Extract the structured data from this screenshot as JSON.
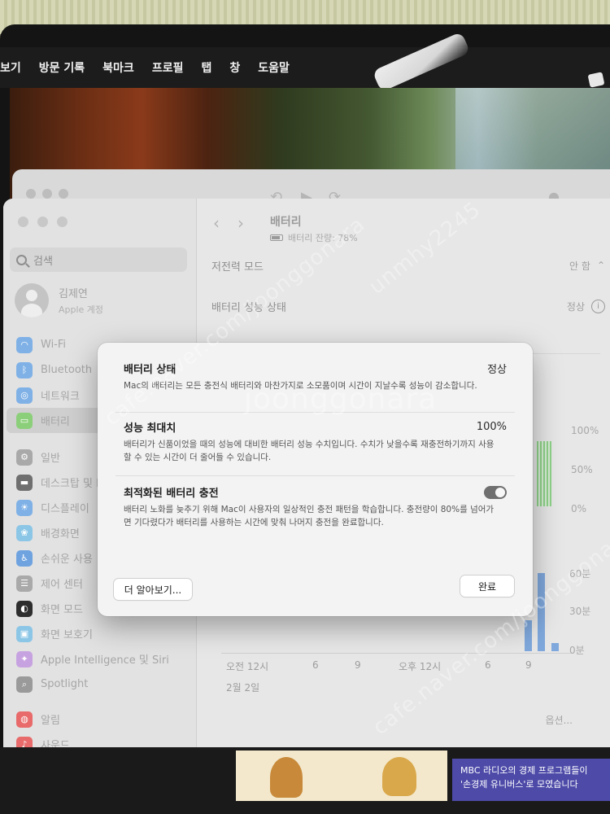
{
  "menubar": {
    "items": [
      "보기",
      "방문 기록",
      "북마크",
      "프로필",
      "탭",
      "창",
      "도움말"
    ]
  },
  "settings": {
    "search_placeholder": "검색",
    "user": {
      "name": "김제연",
      "subtitle": "Apple 계정"
    },
    "sidebar_items": [
      {
        "label": "Wi-Fi",
        "icon": "wifi-icon",
        "color": "#7fb1e6"
      },
      {
        "label": "Bluetooth",
        "icon": "bluetooth-icon",
        "color": "#7fb1e6"
      },
      {
        "label": "네트워크",
        "icon": "globe-icon",
        "color": "#7fb1e6"
      },
      {
        "label": "배터리",
        "icon": "battery-icon",
        "color": "#8ccf7a",
        "active": true
      },
      {
        "label": "일반",
        "icon": "gear-icon",
        "color": "#a9a9a9"
      },
      {
        "label": "데스크탑 및 Dock",
        "icon": "dock-icon",
        "color": "#6f6f6f"
      },
      {
        "label": "디스플레이",
        "icon": "display-icon",
        "color": "#7fb1e6"
      },
      {
        "label": "배경화면",
        "icon": "wallpaper-icon",
        "color": "#8cc6e6"
      },
      {
        "label": "손쉬운 사용",
        "icon": "accessibility-icon",
        "color": "#6fa3e0"
      },
      {
        "label": "제어 센터",
        "icon": "control-center-icon",
        "color": "#a9a9a9"
      },
      {
        "label": "화면 모드",
        "icon": "appearance-icon",
        "color": "#2e2e2e"
      },
      {
        "label": "화면 보호기",
        "icon": "screensaver-icon",
        "color": "#8cc6e6"
      },
      {
        "label": "Apple Intelligence 및 Siri",
        "icon": "siri-icon",
        "color": "#c7a2e0"
      },
      {
        "label": "Spotlight",
        "icon": "spotlight-icon",
        "color": "#9a9a9a"
      },
      {
        "label": "알림",
        "icon": "bell-icon",
        "color": "#e86a6a"
      },
      {
        "label": "사운드",
        "icon": "speaker-icon",
        "color": "#e86a6a"
      }
    ],
    "main": {
      "title": "배터리",
      "subtitle": "배터리 잔량: 78%",
      "low_power": {
        "label": "저전력 모드",
        "value": "안 함"
      },
      "health": {
        "label": "배터리 성능 상태",
        "value": "정상"
      },
      "options_label": "옵션..."
    },
    "chart": {
      "level_ticks": [
        "100%",
        "50%",
        "0%"
      ],
      "usage_ticks": [
        "60분",
        "30분",
        "0분"
      ],
      "x_ticks": [
        "오전 12시",
        "6",
        "9",
        "오후 12시",
        "6",
        "9"
      ],
      "date_label": "2월 2일"
    }
  },
  "dialog": {
    "status": {
      "title": "배터리 상태",
      "value": "정상",
      "description": "Mac의 배터리는 모든 충전식 배터리와 마찬가지로 소모품이며 시간이 지날수록 성능이 감소합니다."
    },
    "max_capacity": {
      "title": "성능 최대치",
      "value": "100%",
      "description": "배터리가 신품이었을 때의 성능에 대비한 배터리 성능 수치입니다. 수치가 낮을수록 재충전하기까지 사용할 수 있는 시간이 더 줄어들 수 있습니다."
    },
    "optimized": {
      "title": "최적화된 배터리 충전",
      "enabled": true,
      "description": "배터리 노화를 늦추기 위해 Mac이 사용자의 일상적인 충전 패턴을 학습합니다. 충전량이 80%를 넘어가면 기다렸다가 배터리를 사용하는 시간에 맞춰 나머지 충전을 완료합니다."
    },
    "learn_more": "더 알아보기...",
    "done": "완료"
  },
  "ad": {
    "text_line1": "MBC 라디오의 경제 프로그램들이",
    "text_line2": "'손경제 유니버스'로 모였습니다"
  },
  "watermarks": [
    "cafe.naver.com/joonggonara",
    "joonggonara",
    "unmhy2245"
  ]
}
